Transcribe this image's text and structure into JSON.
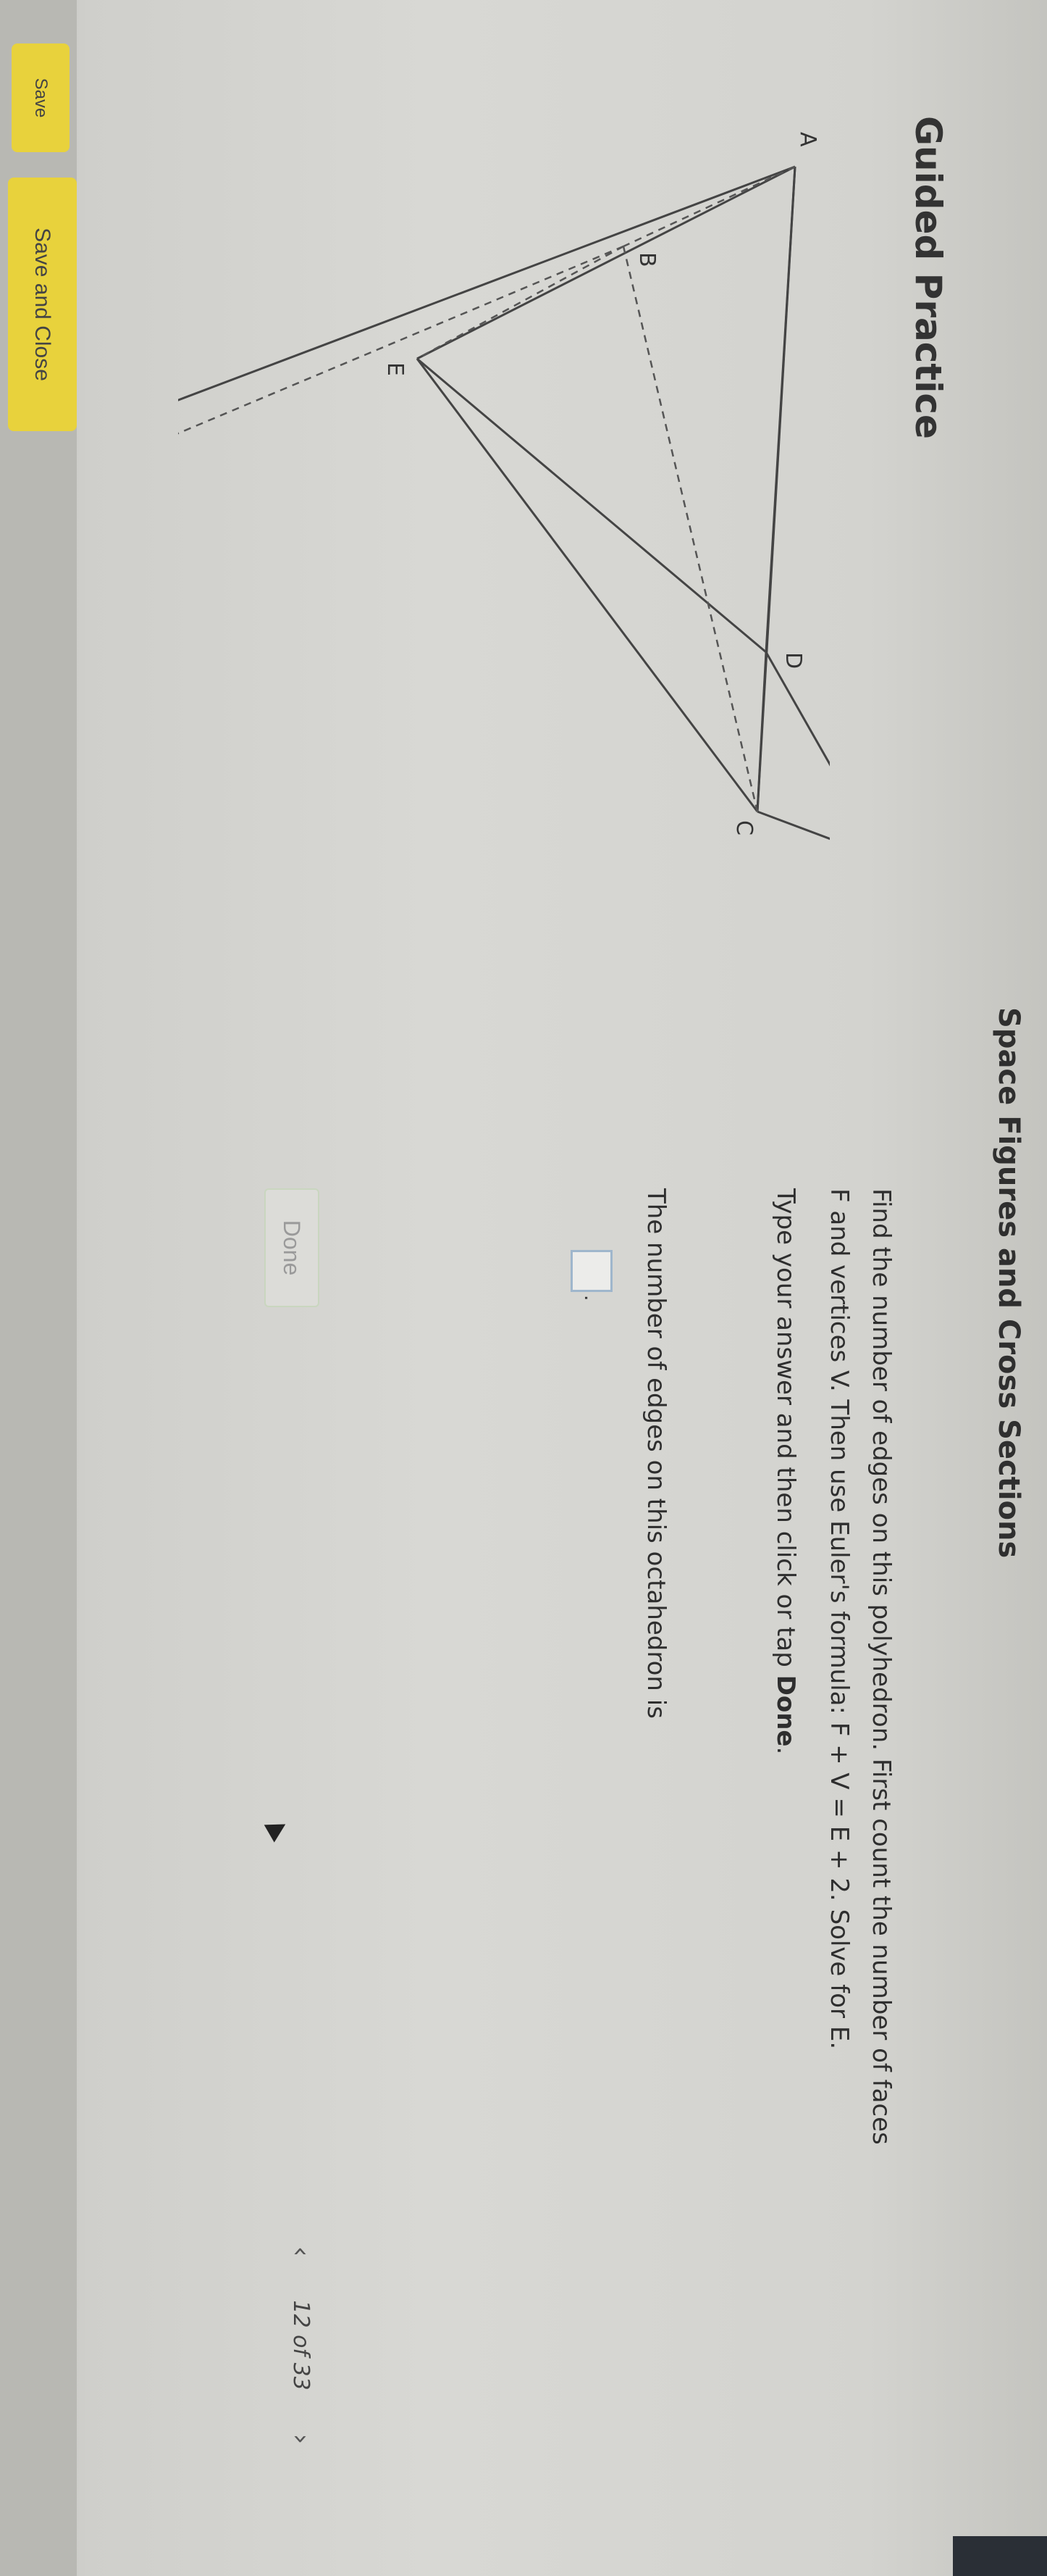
{
  "header": {
    "title": "Space Figures and Cross Sections"
  },
  "section": {
    "heading": "Guided Practice"
  },
  "question": {
    "line1": "Find the number of edges on this polyhedron. First count the number of faces",
    "line2": "F and vertices V. Then use Euler's formula: F + V = E + 2. Solve for E.",
    "line3_prefix": "Type your answer and then click or tap ",
    "line3_bold": "Done",
    "line3_suffix": ".",
    "prompt": "The number of edges on this octahedron is",
    "answer_value": "",
    "answer_period": "."
  },
  "figure": {
    "vertex_labels": {
      "A": "A",
      "B": "B",
      "C": "C",
      "D": "D",
      "E": "E"
    }
  },
  "buttons": {
    "done": "Done",
    "save": "Save",
    "save_close": "Save and Close"
  },
  "pager": {
    "prev_icon": "‹",
    "page_text": "12 of 33",
    "next_icon": "›"
  }
}
